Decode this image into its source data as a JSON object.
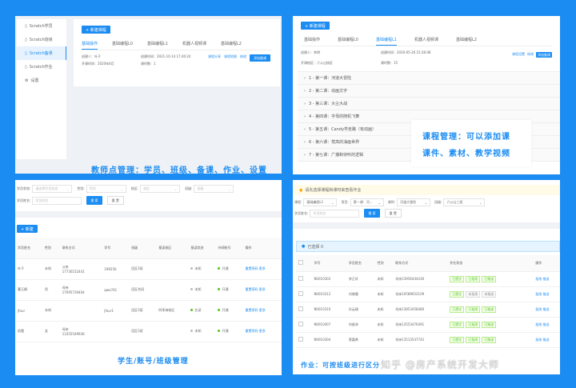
{
  "teacher_panel": {
    "sidebar": [
      {
        "label": "Scratch学员",
        "icon": "doc-icon"
      },
      {
        "label": "Scratch班级",
        "icon": "doc-icon"
      },
      {
        "label": "Scratch备课",
        "icon": "doc-icon",
        "active": true
      },
      {
        "label": "Scratch作业",
        "icon": "doc-icon"
      },
      {
        "label": "设置",
        "icon": "gear-icon"
      }
    ],
    "new_course": "+ 新建课程",
    "tabs": [
      "基础操作",
      "基础编程L0",
      "基础编程L1",
      "机器人视频课",
      "基础编程L2"
    ],
    "creator": "创建人：叶子",
    "start_time": "开课时间：2020年6月",
    "created": "创建时间：2021-10-14 17:40:24",
    "lessons": "课时数：1",
    "actions": [
      "课程分享",
      "课程地图",
      "修改"
    ],
    "add_prep": "添加备课",
    "caption": "教师点管理：学员、班级、备课、作业、设置"
  },
  "course_panel": {
    "new_course": "+ 新建课程",
    "tabs": [
      "基础操作",
      "基础编程L0",
      "基础编程L1",
      "机器人视频课",
      "基础编程L2"
    ],
    "creator": "创建人：李明",
    "created": "创建时间：2020-05-26 15:26:08",
    "campus": "开课校区：六公山校区",
    "lessons": "课时数：15",
    "actions": [
      "课程设置",
      "修改"
    ],
    "add_prep": "添加备课",
    "lesson_list": [
      "1 - 第一课：河道大冒险",
      "2 - 第二课：动画文字",
      "3 - 第三课：大尘大战",
      "4 - 第四课：字母的随机飞舞",
      "5 - 第五课：Candy学走路（有动画）",
      "6 - 第六课：梵高的油画世界",
      "7 - 第七课：广播和侦听的逻辑"
    ],
    "caption_line1": "课程管理：可以添加课",
    "caption_line2": "课件、素材、教学视频"
  },
  "student_panel": {
    "filters": {
      "status_label": "学员状态:",
      "status_ph": "请选择学员状态",
      "gender_label": "性别:",
      "gender_ph": "性别",
      "campus_label": "校区:",
      "campus_ph": "校区",
      "class_label": "班级:",
      "class_ph": "班级",
      "name_label": "学员姓名:",
      "name_ph": "学员姓名"
    },
    "search": "搜 索",
    "reset": "重 置",
    "new": "+ 新建",
    "headers": [
      "学员姓名",
      "性别",
      "联系方式",
      "学号",
      "班级",
      "报读校区",
      "报读状态",
      "外网账号",
      "操作"
    ],
    "rows": [
      {
        "name": "叶子",
        "gender": "未知",
        "contact1": "父亲",
        "contact2": "17730152441",
        "id": "199256",
        "class": "回区3班",
        "campus": "",
        "status": "未知",
        "account": "开通"
      },
      {
        "name": "曹玉娟",
        "gender": "男",
        "contact1": "母亲",
        "contact2": "17095739404",
        "id": "qwe741",
        "class": "回区合班",
        "campus": "",
        "status": "未知",
        "account": "开通"
      },
      {
        "name": "jfour",
        "gender": "未知",
        "contact1": "",
        "contact2": "",
        "id": "jfour1",
        "class": "回区3班",
        "campus": "四季海校区",
        "status": "在读",
        "account": "开通"
      },
      {
        "name": "俞霞",
        "gender": "女",
        "contact1": "母亲",
        "contact2": "13355549936",
        "id": "",
        "class": "回区3班",
        "campus": "",
        "status": "未知",
        "account": "开通"
      }
    ],
    "row_actions": [
      "重置密码",
      "更多"
    ],
    "caption": "学生/账号/班级管理"
  },
  "homework_panel": {
    "notice": "请先选择课程和课时来查看作业",
    "filters": {
      "course_label": "课程:",
      "course": "基础编程L1",
      "chapter_label": "项目:",
      "chapter": "第一课：河...",
      "lesson_label": "课时:",
      "lesson": "河道大冒险",
      "class_label": "班级:",
      "class": "六公山三班",
      "name_label": "学员姓名:",
      "name_ph": "学员姓名"
    },
    "search": "搜 索",
    "reset": "重 置",
    "selected": "已选择 0",
    "headers": [
      "学号",
      "学员姓名",
      "性别",
      "联系方式",
      "作业状态",
      "操作"
    ],
    "rows": [
      {
        "id": "N0010302",
        "name": "李正轩",
        "gender": "未知",
        "contact": "母亲13956444430",
        "tags": [
          "已提交",
          "已批改",
          "已推送"
        ]
      },
      {
        "id": "N0010312",
        "name": "刘晓晨",
        "gender": "未知",
        "contact": "母亲10589652109",
        "tags": [
          "已提交",
          "未批改",
          "未推送"
        ]
      },
      {
        "id": "N0010310",
        "name": "孙云缙",
        "gender": "未知",
        "contact": "母亲13853458480",
        "tags": [
          "已提交",
          "已批改",
          "已推送"
        ]
      },
      {
        "id": "N0010407",
        "name": "何俊泽",
        "gender": "未知",
        "contact": "母亲13553476491",
        "tags": [
          "已提交",
          "已批改",
          "已推送"
        ]
      },
      {
        "id": "N0010304",
        "name": "贾嘉希",
        "gender": "未知",
        "contact": "母亲13513547742",
        "tags": [
          "已提交",
          "已批改",
          "已推送"
        ]
      }
    ],
    "row_actions": [
      "批改",
      "推送"
    ],
    "caption": "作业：可按班级进行区分",
    "watermark": "知乎 @房产系统开发大师"
  }
}
